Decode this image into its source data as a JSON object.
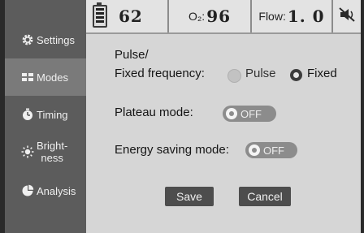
{
  "status": {
    "battery_icon": "battery-icon",
    "battery_value": "62",
    "o2_label": "O₂:",
    "o2_value": "96",
    "flow_label": "Flow:",
    "flow_value": "1. 0",
    "mute_icon": "alarm-mute-icon"
  },
  "sidebar": {
    "items": [
      {
        "label": "Settings",
        "icon": "gear-icon"
      },
      {
        "label": "Modes",
        "icon": "modes-grid-icon",
        "active": true
      },
      {
        "label": "Timing",
        "icon": "stopwatch-icon"
      },
      {
        "label_line1": "Bright-",
        "label_line2": "ness",
        "icon": "sun-icon"
      },
      {
        "label": "Analysis",
        "icon": "pie-chart-icon"
      }
    ]
  },
  "content": {
    "pulse_title": "Pulse/",
    "fixed_freq_label": "Fixed frequency:",
    "option_pulse": "Pulse",
    "option_fixed": "Fixed",
    "selected_option": "Fixed",
    "plateau_label": "Plateau mode:",
    "plateau_state": "OFF",
    "energy_label": "Energy saving mode:",
    "energy_state": "OFF",
    "save_label": "Save",
    "cancel_label": "Cancel"
  },
  "colors": {
    "sidebar": "#5c5c5c",
    "sidebar_active": "#7a7a7a",
    "content_bg": "#d6d6d6",
    "button": "#4d4d4d",
    "toggle": "#8c8c8c"
  }
}
